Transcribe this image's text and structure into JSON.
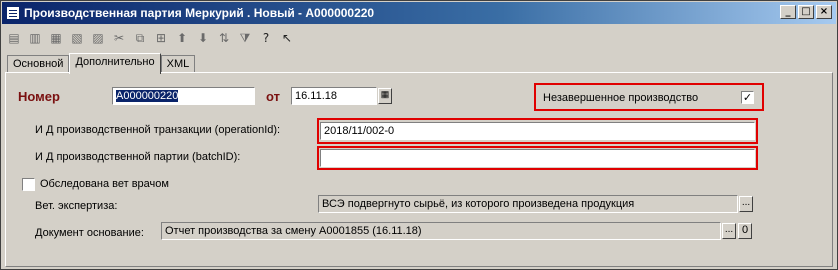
{
  "window": {
    "title": "Производственная партия Меркурий . Новый - А000000220"
  },
  "tabs": [
    "Основной",
    "Дополнительно",
    "XML"
  ],
  "form": {
    "number_label": "Номер",
    "number_value": "А000000220",
    "date_label": "от",
    "date_value": "16.11.18",
    "wip_label": "Незавершенное производство",
    "wip_checked": "✓",
    "operation_label": "И Д производственной транзакции (operationId):",
    "operation_value": "2018/11/002-0",
    "batch_label": "И Д производственной партии (batchID):",
    "batch_value": "",
    "vet_check_label": "Обследована вет врачом",
    "vet_expertise_label": "Вет. экспертиза:",
    "vet_expertise_value": "ВСЭ подвергнуто сырьё, из которого произведена продукция",
    "doc_label": "Документ основание:",
    "doc_value": "Отчет производства за смену А0001855 (16.11.18)",
    "ellipsis": "...",
    "clear_btn": "0"
  },
  "toolbar_icons": [
    "new-doc-icon",
    "new-copy-icon",
    "new-group-icon",
    "edit-icon",
    "delete-icon",
    "cut-icon",
    "link-icon",
    "hierarchy-icon",
    "move-up-icon",
    "move-down-icon",
    "sort-icon",
    "filter-icon",
    "help-icon",
    "pointer-help-icon"
  ]
}
